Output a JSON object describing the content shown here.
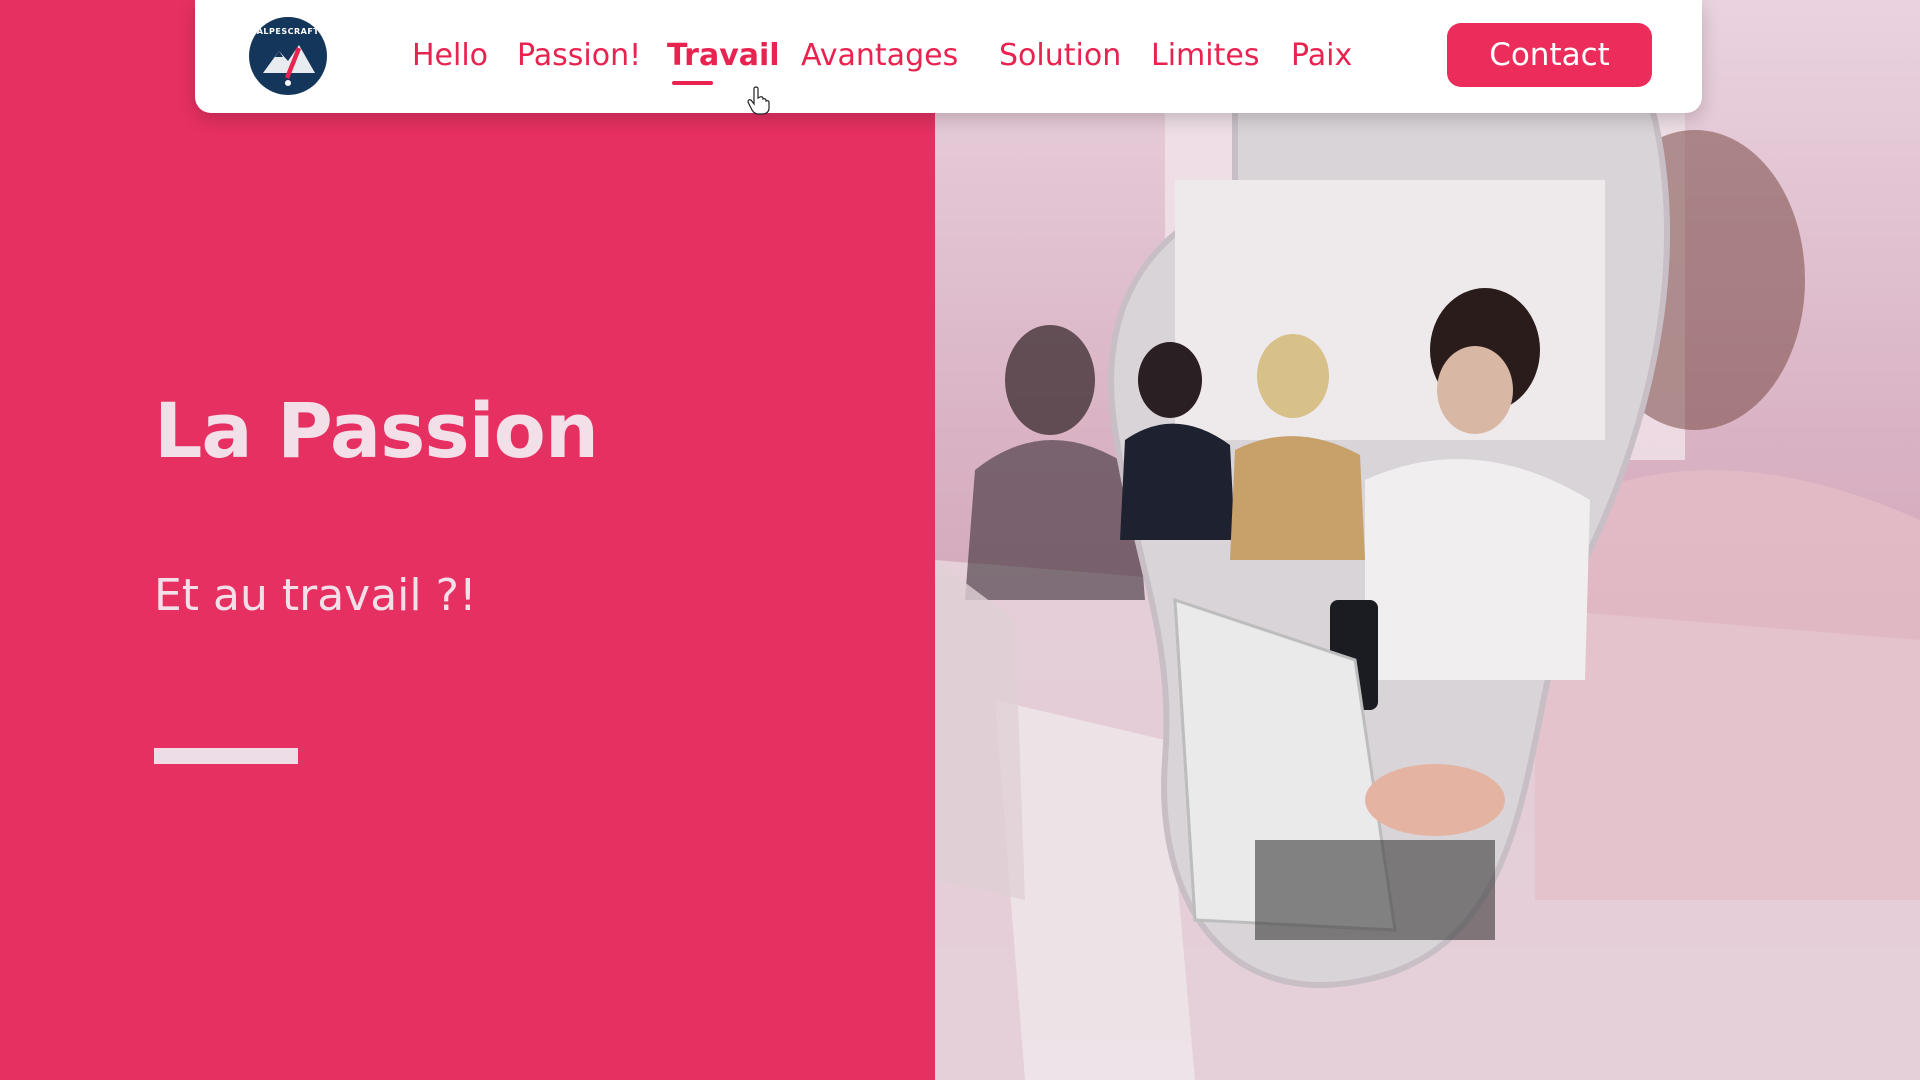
{
  "nav": {
    "logo_text": "ALPESCRAFT",
    "items": [
      {
        "label": "Hello"
      },
      {
        "label": "Passion!"
      },
      {
        "label": "Travail"
      },
      {
        "label": "Avantages"
      },
      {
        "label": "Solution"
      },
      {
        "label": "Limites"
      },
      {
        "label": "Paix"
      }
    ],
    "active": "Travail",
    "contact_label": "Contact"
  },
  "hero": {
    "title": "La Passion",
    "subtitle": "Et au travail ?!"
  },
  "colors": {
    "brand": "#e63062",
    "accent_text": "#e8234f",
    "hero_text": "#f3dfe8",
    "logo_bg": "#14365a"
  },
  "icons": {
    "logo": "alpescraft-mountain-logo",
    "cursor": "hand-pointer-cursor"
  }
}
